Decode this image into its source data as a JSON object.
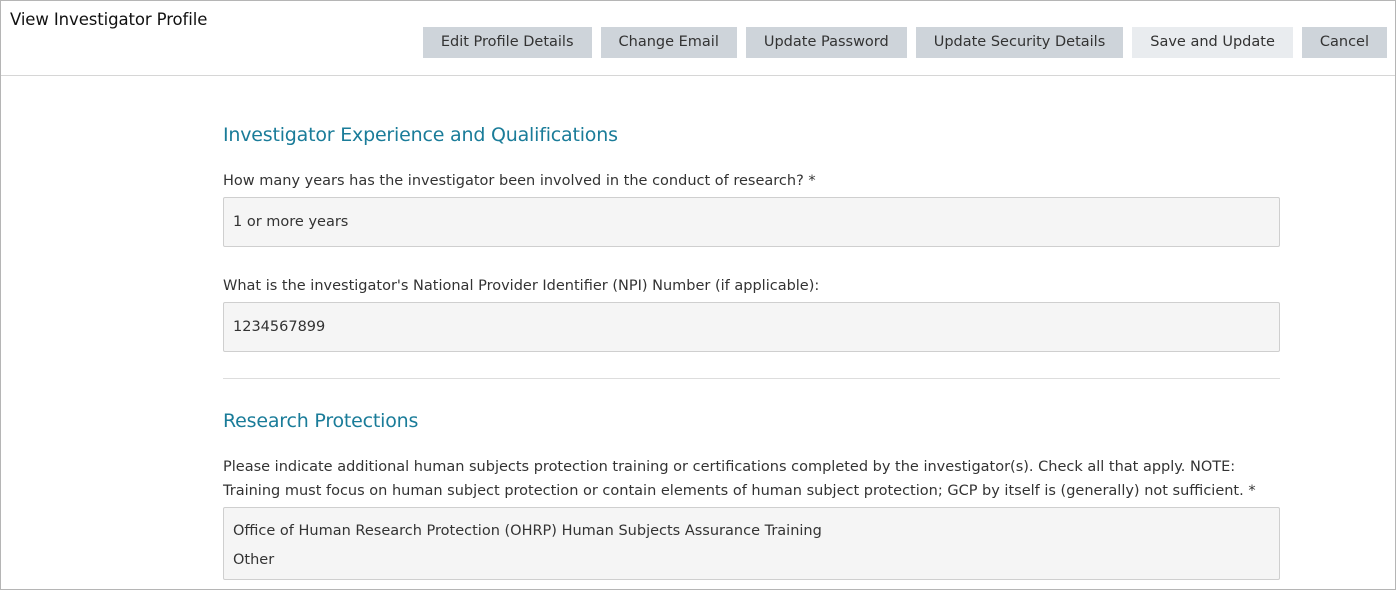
{
  "header": {
    "title": "View Investigator Profile",
    "buttons": {
      "edit_profile": "Edit Profile Details",
      "change_email": "Change Email",
      "update_password": "Update Password",
      "update_security": "Update Security Details",
      "save_update": "Save and Update",
      "cancel": "Cancel"
    }
  },
  "experience": {
    "title": "Investigator Experience and Qualifications",
    "years_question": "How many years has the investigator been involved in the conduct of research? *",
    "years_value": "1 or more years",
    "npi_question": "What is the investigator's National Provider Identifier (NPI) Number (if applicable):",
    "npi_value": "1234567899"
  },
  "protections": {
    "title": "Research Protections",
    "training_question": "Please indicate additional human subjects protection training or certifications completed by the investigator(s). Check all that apply. NOTE: Training must focus on human subject protection or contain elements of human subject protection; GCP by itself is (generally) not sufficient. *",
    "training_values": [
      "Office of Human Research Protection (OHRP) Human Subjects Assurance Training",
      "Other"
    ]
  }
}
